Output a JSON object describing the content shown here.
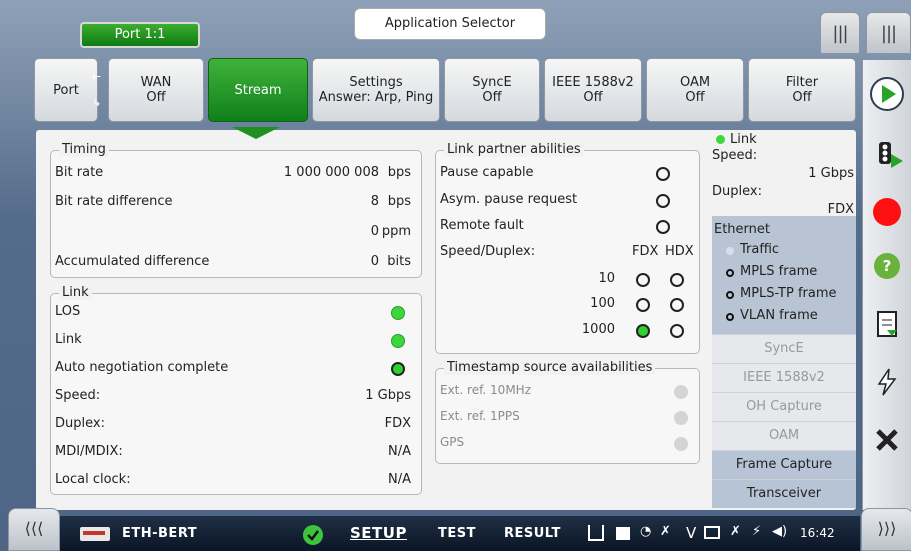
{
  "top": {
    "port_label": "Port 1:1",
    "app_selector": "Application Selector"
  },
  "tabs": [
    {
      "line1": "Port",
      "line2": ""
    },
    {
      "line1": "WAN",
      "line2": "Off"
    },
    {
      "line1": "Stream",
      "line2": ""
    },
    {
      "line1": "Settings",
      "line2": "Answer: Arp, Ping"
    },
    {
      "line1": "SyncE",
      "line2": "Off"
    },
    {
      "line1": "IEEE 1588v2",
      "line2": "Off"
    },
    {
      "line1": "OAM",
      "line2": "Off"
    },
    {
      "line1": "Filter",
      "line2": "Off"
    }
  ],
  "timing": {
    "title": "Timing",
    "bit_rate_label": "Bit rate",
    "bit_rate_value": "1 000 000 008",
    "bit_rate_unit": "bps",
    "bit_rate_diff_label": "Bit rate difference",
    "bit_rate_diff_value": "8",
    "bit_rate_diff_unit": "bps",
    "ppm_value": "0",
    "ppm_unit": "ppm",
    "acc_label": "Accumulated difference",
    "acc_value": "0",
    "acc_unit": "bits"
  },
  "link": {
    "title": "Link",
    "los_label": "LOS",
    "link_label": "Link",
    "auto_neg_label": "Auto negotiation complete",
    "speed_label": "Speed:",
    "speed_value": "1 Gbps",
    "duplex_label": "Duplex:",
    "duplex_value": "FDX",
    "mdi_label": "MDI/MDIX:",
    "mdi_value": "N/A",
    "clock_label": "Local clock:",
    "clock_value": "N/A"
  },
  "partner": {
    "title": "Link partner abilities",
    "pause_label": "Pause capable",
    "asym_label": "Asym. pause request",
    "remote_label": "Remote fault",
    "speed_duplex_label": "Speed/Duplex:",
    "fdx": "FDX",
    "hdx": "HDX",
    "speeds": [
      "10",
      "100",
      "1000"
    ]
  },
  "timestamp": {
    "title": "Timestamp source availabilities",
    "items": [
      "Ext. ref. 10MHz",
      "Ext. ref. 1PPS",
      "GPS"
    ]
  },
  "status": {
    "link_label": "Link",
    "speed_label": "Speed:",
    "speed_value": "1 Gbps",
    "duplex_label": "Duplex:",
    "duplex_value": "FDX",
    "ethernet_label": "Ethernet",
    "eth_items": [
      "Traffic",
      "MPLS frame",
      "MPLS-TP frame",
      "VLAN frame"
    ],
    "buttons": [
      "SyncE",
      "IEEE 1588v2",
      "OH Capture",
      "OAM",
      "Frame Capture",
      "Transceiver"
    ]
  },
  "bottom": {
    "app_name": "ETH-BERT",
    "setup": "SETUP",
    "test": "TEST",
    "result": "RESULT",
    "time": "16:42"
  },
  "colors": {
    "green_active": "#1f8f22",
    "led_green": "#3cd73c",
    "record_red": "#ff0000",
    "eth_box": "#b8c4d4"
  }
}
